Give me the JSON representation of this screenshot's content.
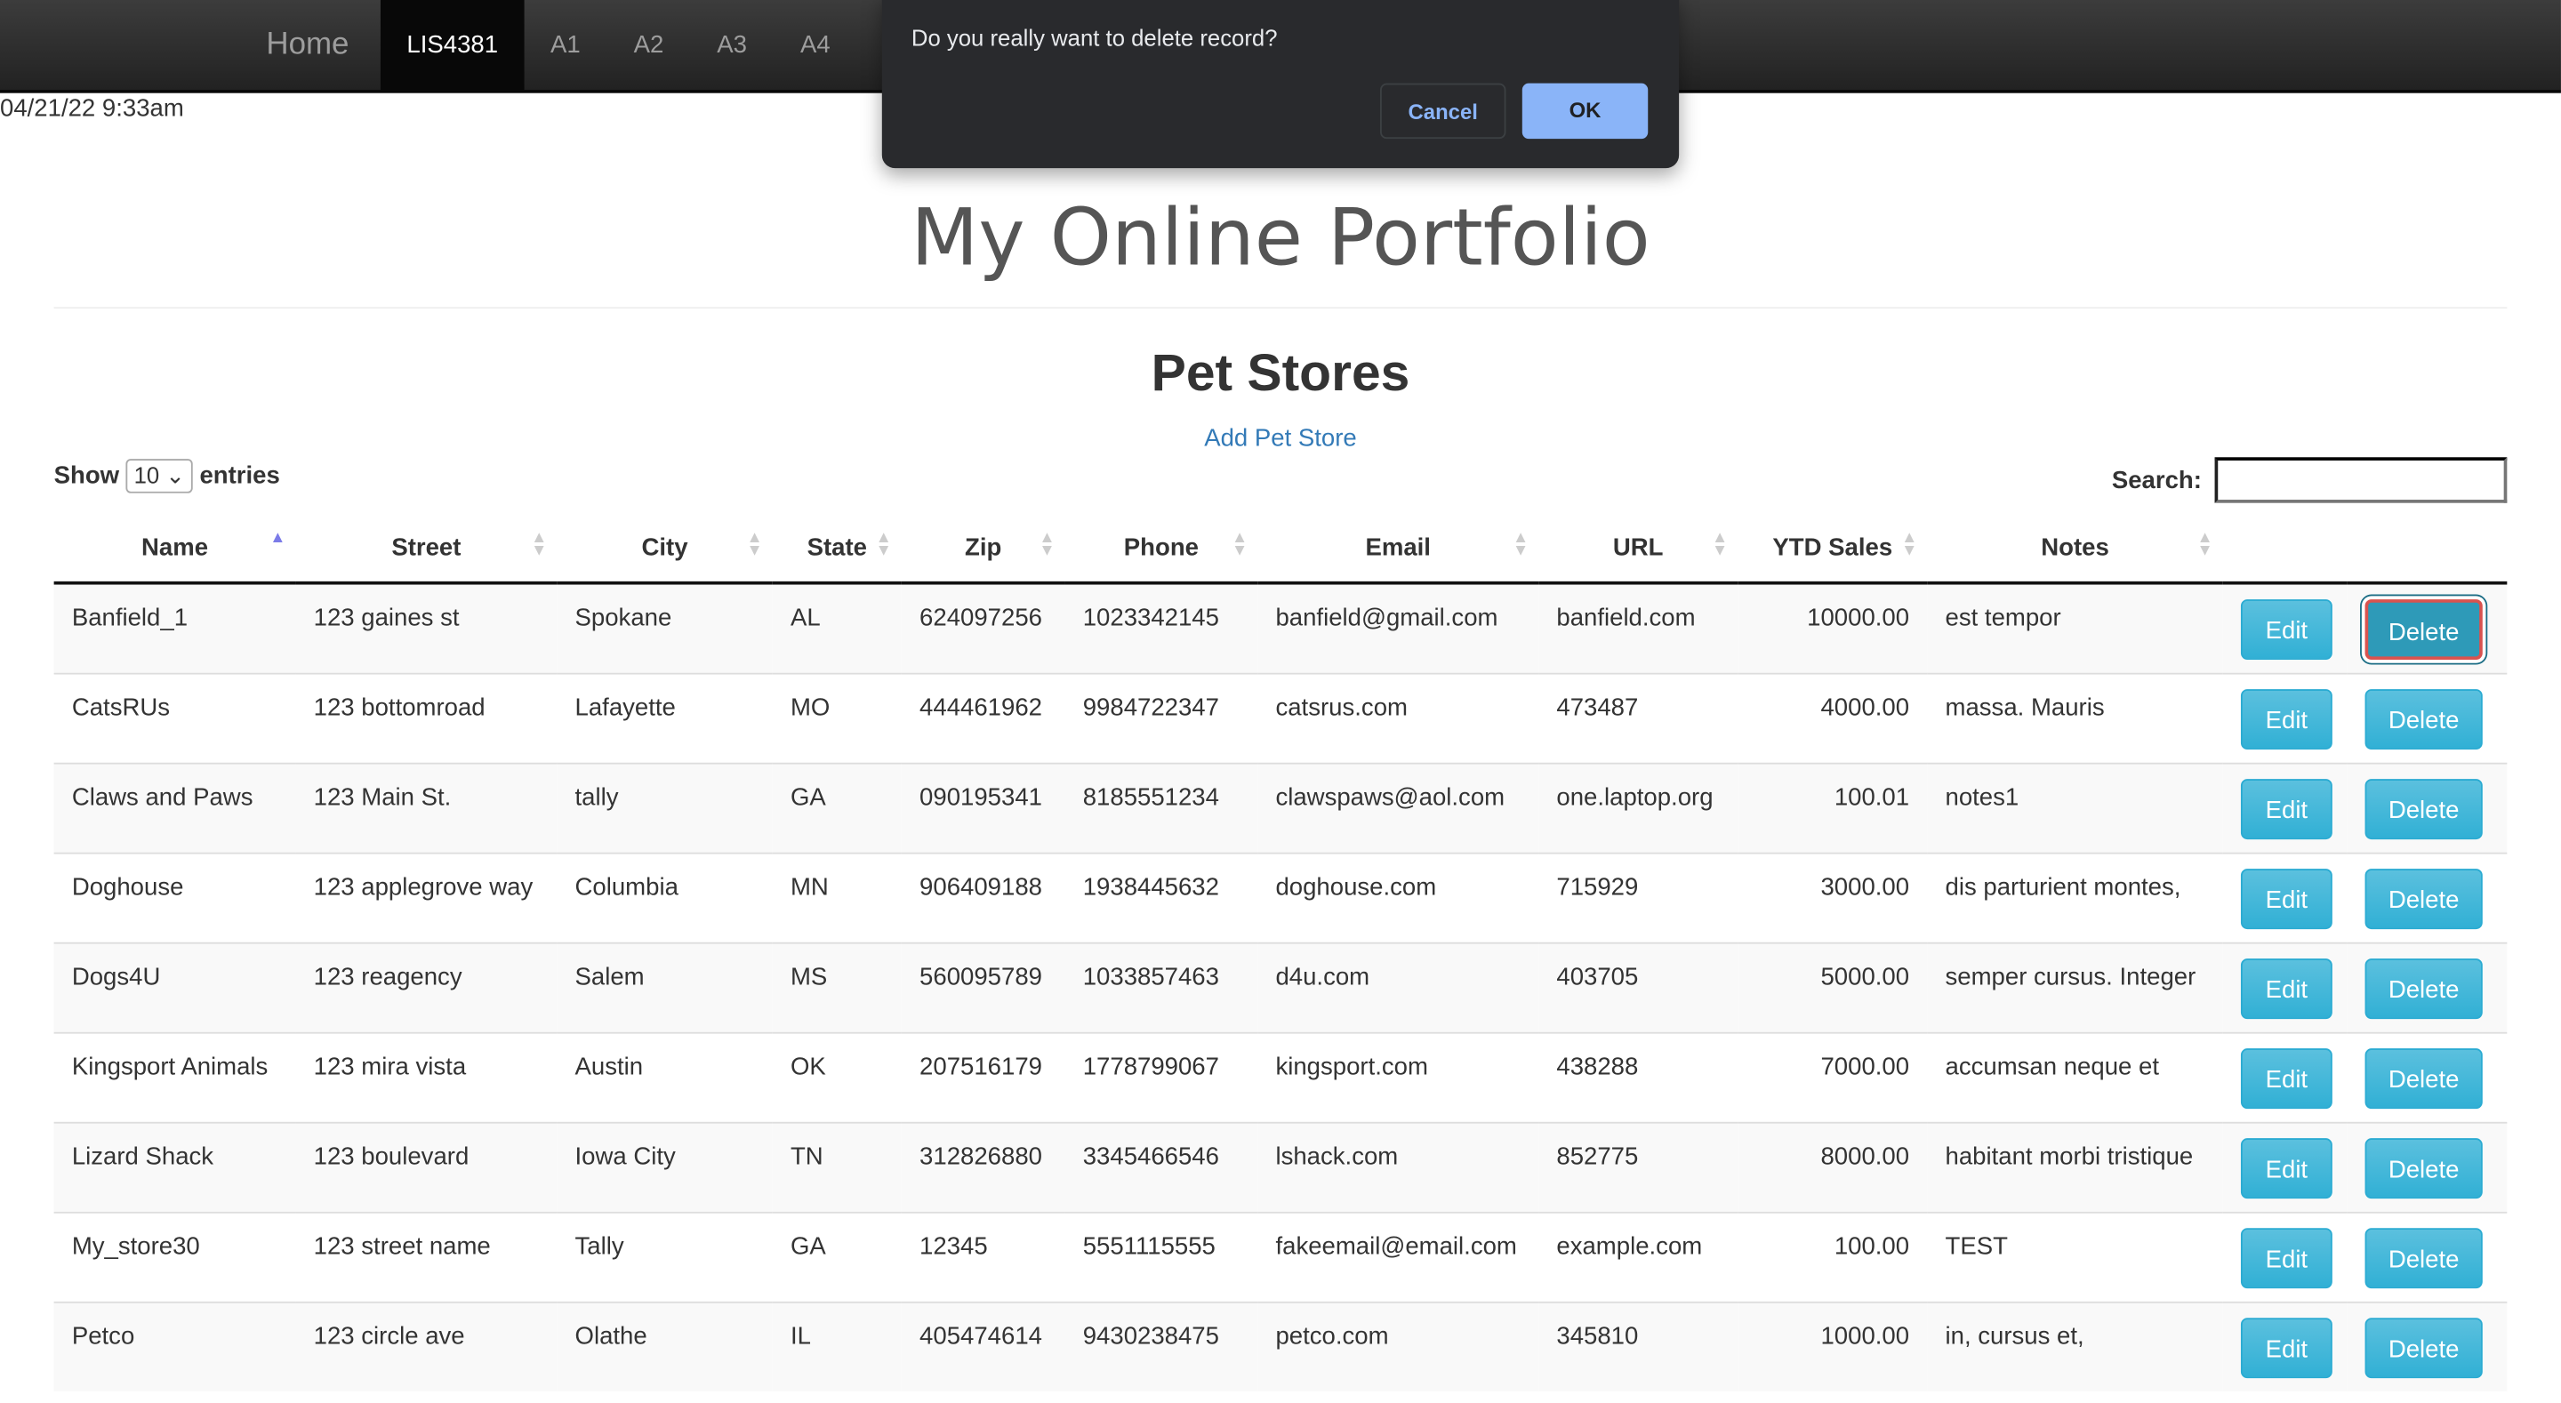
{
  "nav": {
    "brand": "Home",
    "items": [
      "LIS4381",
      "A1",
      "A2",
      "A3",
      "A4"
    ]
  },
  "timestamp": "04/21/22 9:33am",
  "dialog": {
    "message": "Do you really want to delete record?",
    "cancel": "Cancel",
    "ok": "OK"
  },
  "page_title": "My Online Portfolio",
  "section_title": "Pet Stores",
  "add_link": "Add Pet Store",
  "length": {
    "show": "Show",
    "value": "10",
    "entries": "entries"
  },
  "search": {
    "label": "Search:",
    "value": ""
  },
  "columns": [
    "Name",
    "Street",
    "City",
    "State",
    "Zip",
    "Phone",
    "Email",
    "URL",
    "YTD Sales",
    "Notes"
  ],
  "actions": {
    "edit": "Edit",
    "delete": "Delete"
  },
  "rows": [
    [
      "Banfield_1",
      "123 gaines st",
      "Spokane",
      "AL",
      "624097256",
      "1023342145",
      "banfield@gmail.com",
      "banfield.com",
      "10000.00",
      "est tempor"
    ],
    [
      "CatsRUs",
      "123 bottomroad",
      "Lafayette",
      "MO",
      "444461962",
      "9984722347",
      "catsrus.com",
      "473487",
      "4000.00",
      "massa. Mauris"
    ],
    [
      "Claws and Paws",
      "123 Main St.",
      "tally",
      "GA",
      "090195341",
      "8185551234",
      "clawspaws@aol.com",
      "one.laptop.org",
      "100.01",
      "notes1"
    ],
    [
      "Doghouse",
      "123 applegrove way",
      "Columbia",
      "MN",
      "906409188",
      "1938445632",
      "doghouse.com",
      "715929",
      "3000.00",
      "dis parturient montes,"
    ],
    [
      "Dogs4U",
      "123 reagency",
      "Salem",
      "MS",
      "560095789",
      "1033857463",
      "d4u.com",
      "403705",
      "5000.00",
      "semper cursus. Integer"
    ],
    [
      "Kingsport Animals",
      "123 mira vista",
      "Austin",
      "OK",
      "207516179",
      "1778799067",
      "kingsport.com",
      "438288",
      "7000.00",
      "accumsan neque et"
    ],
    [
      "Lizard Shack",
      "123 boulevard",
      "Iowa City",
      "TN",
      "312826880",
      "3345466546",
      "lshack.com",
      "852775",
      "8000.00",
      "habitant morbi tristique"
    ],
    [
      "My_store30",
      "123 street name",
      "Tally",
      "GA",
      "12345",
      "5551115555",
      "fakeemail@email.com",
      "example.com",
      "100.00",
      "TEST"
    ],
    [
      "Petco",
      "123 circle ave",
      "Olathe",
      "IL",
      "405474614",
      "9430238475",
      "petco.com",
      "345810",
      "1000.00",
      "in, cursus et,"
    ]
  ]
}
